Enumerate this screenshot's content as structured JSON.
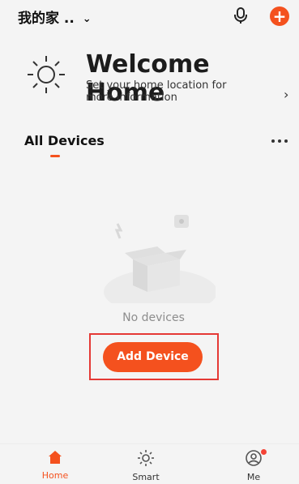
{
  "header": {
    "home_name": "我的家 ..",
    "chevron": "⌄",
    "mic_icon": "microphone-icon",
    "add_icon": "plus-icon"
  },
  "welcome": {
    "title": "Welcome Home",
    "description": "Set your home location for more information",
    "arrow": "›"
  },
  "devices": {
    "section_title": "All Devices",
    "more_icon": "more-icon",
    "empty_text": "No devices",
    "add_button": "Add Device"
  },
  "bottom_nav": [
    {
      "label": "Home",
      "icon": "home-icon",
      "active": true
    },
    {
      "label": "Smart",
      "icon": "sun-icon",
      "active": false
    },
    {
      "label": "Me",
      "icon": "profile-icon",
      "active": false
    }
  ],
  "colors": {
    "accent": "#f4511e",
    "highlight": "#e53935"
  }
}
